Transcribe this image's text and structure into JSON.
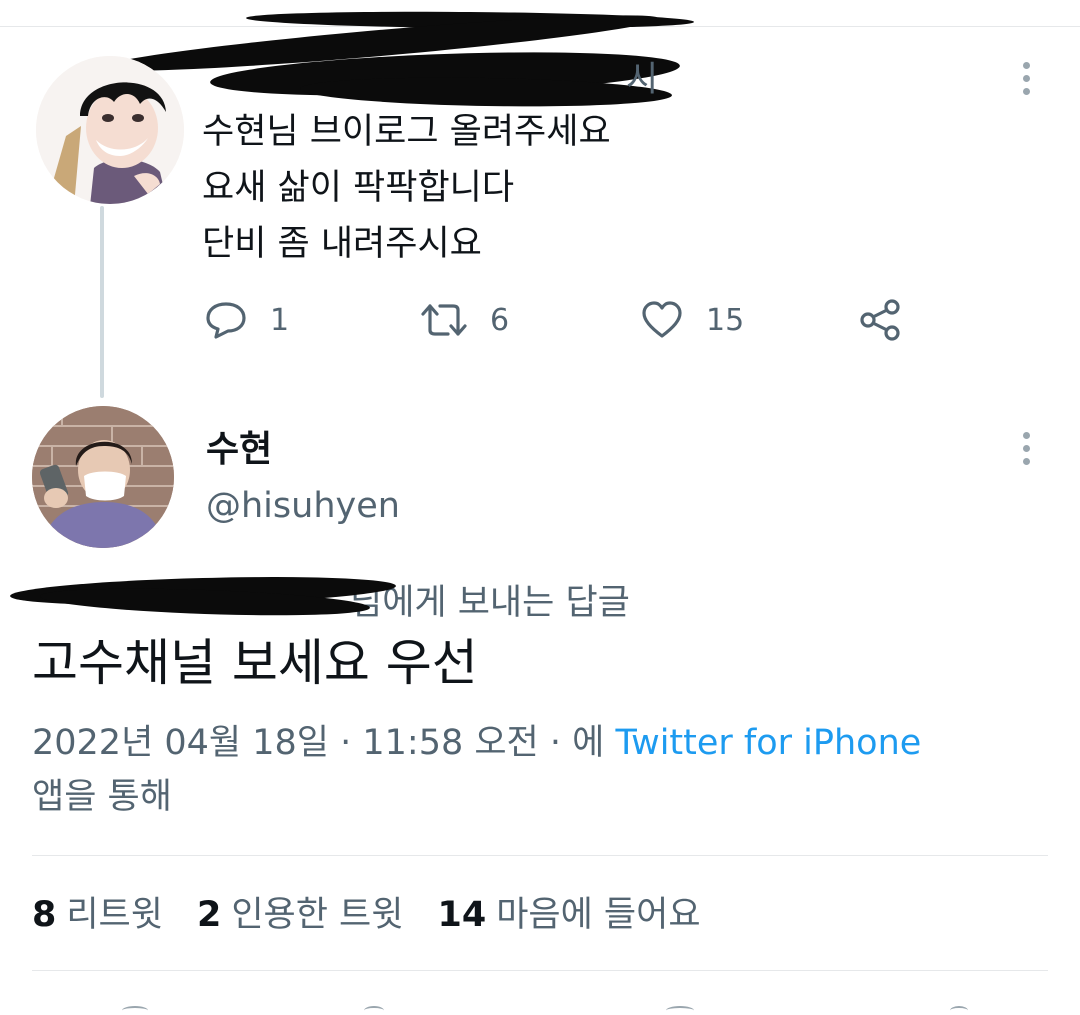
{
  "parent_tweet": {
    "display_name_visible": "시",
    "lines": [
      "수현님 브이로그 올려주세요",
      "요새 삶이 팍팍합니다",
      "단비 좀 내려주시요"
    ],
    "actions": {
      "reply_icon": "reply-icon",
      "reply_count": "1",
      "retweet_icon": "retweet-icon",
      "retweet_count": "6",
      "like_icon": "heart-icon",
      "like_count": "15",
      "share_icon": "share-icon"
    },
    "more_icon": "more-vertical-icon"
  },
  "main_tweet": {
    "display_name": "수현",
    "handle": "@hisuhyen",
    "reply_to_suffix": "님에게 보내는 답글",
    "text": "고수채널 보세요 우선",
    "timestamp": "2022년 04월 18일 · 11:58 오전 · 에",
    "via_app": "Twitter for iPhone",
    "via_suffix": "앱을 통해",
    "more_icon": "more-vertical-icon"
  },
  "stats": {
    "retweets_count": "8",
    "retweets_label": "리트윗",
    "quotes_count": "2",
    "quotes_label": "인용한 트윗",
    "likes_count": "14",
    "likes_label": "마음에 들어요"
  },
  "colors": {
    "text_primary": "#0f1419",
    "text_secondary": "#536471",
    "link_blue": "#1d9bf0",
    "divider": "#e6e8ea",
    "thread_line": "#cfd9de"
  }
}
